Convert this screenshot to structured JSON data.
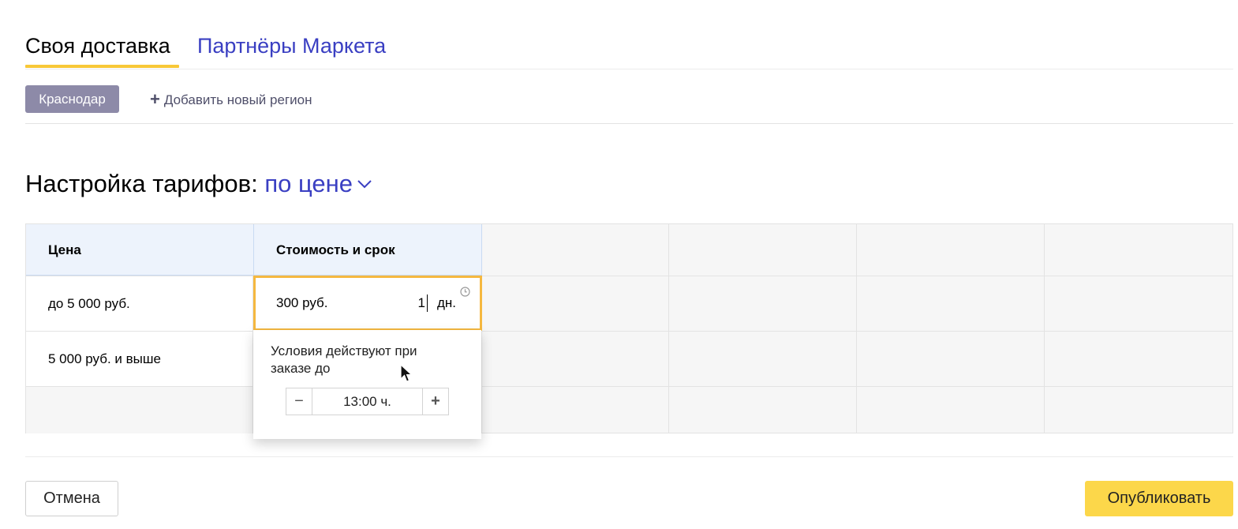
{
  "tabs": [
    {
      "label": "Своя доставка",
      "active": true
    },
    {
      "label": "Партнёры Маркета",
      "active": false
    }
  ],
  "regions": {
    "active_region": "Краснодар",
    "add_region_label": "Добавить новый регион"
  },
  "tariff": {
    "heading": "Настройка тарифов:",
    "mode": "по цене"
  },
  "table": {
    "headers": [
      "Цена",
      "Стоимость и срок"
    ],
    "rows": [
      {
        "price": "до 5 000 руб.",
        "cost": "300 руб.",
        "days": "1",
        "days_unit": "дн."
      },
      {
        "price": "5 000 руб. и выше"
      }
    ]
  },
  "popup": {
    "text": "Условия действуют при заказе до",
    "time_value": "13:00 ч.",
    "minus": "−",
    "plus": "+"
  },
  "footer": {
    "cancel_label": "Отмена",
    "publish_label": "Опубликовать"
  },
  "colors": {
    "accent_yellow": "#fcd74a",
    "link_blue": "#3a3fc2",
    "chip_purple": "#8d8aa8",
    "active_border": "#f5b840",
    "header_blue": "#edf3fc"
  }
}
